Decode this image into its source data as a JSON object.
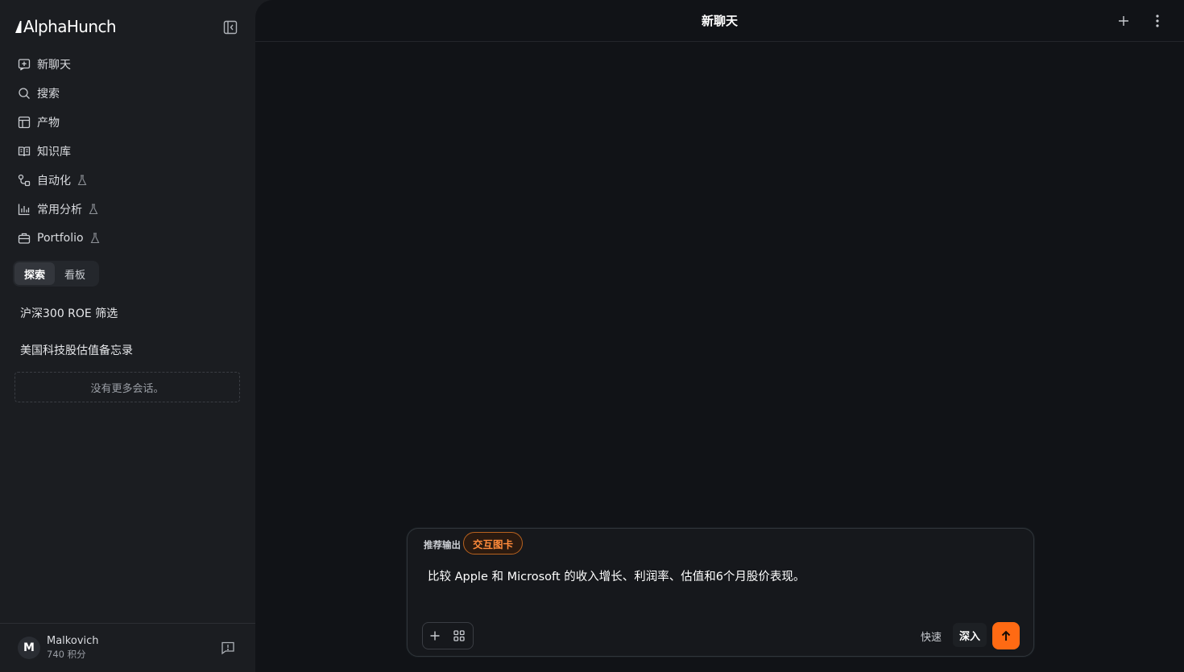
{
  "brand": {
    "name": "AlphaHunch"
  },
  "sidebar": {
    "nav": [
      {
        "label": "新聊天",
        "icon": "new-chat-icon"
      },
      {
        "label": "搜索",
        "icon": "search-icon"
      },
      {
        "label": "产物",
        "icon": "layout-icon"
      },
      {
        "label": "知识库",
        "icon": "book-icon"
      },
      {
        "label": "自动化",
        "icon": "workflow-icon",
        "beta": true
      },
      {
        "label": "常用分析",
        "icon": "bar-chart-icon",
        "beta": true
      },
      {
        "label": "Portfolio",
        "icon": "briefcase-icon",
        "beta": true
      }
    ],
    "tabs": [
      {
        "label": "探索",
        "active": true
      },
      {
        "label": "看板",
        "active": false
      }
    ],
    "conversations": [
      {
        "title": "沪深300 ROE 筛选"
      },
      {
        "title": "美国科技股估值备忘录"
      }
    ],
    "empty_text": "没有更多会话。"
  },
  "user": {
    "initial": "M",
    "name": "Malkovich",
    "points": "740 积分"
  },
  "main": {
    "title": "新聊天"
  },
  "composer": {
    "recommend_label": "推荐输出",
    "recommend_chip": "交互图卡",
    "prompt": "比较 Apple 和 Microsoft 的收入增长、利润率、估值和6个月股价表现。",
    "mode_fast": "快速",
    "mode_deep": "深入",
    "selected_mode": "深入"
  },
  "colors": {
    "accent": "#ff6a13",
    "sidebar_bg": "#1b1d21",
    "main_bg": "#111317"
  }
}
